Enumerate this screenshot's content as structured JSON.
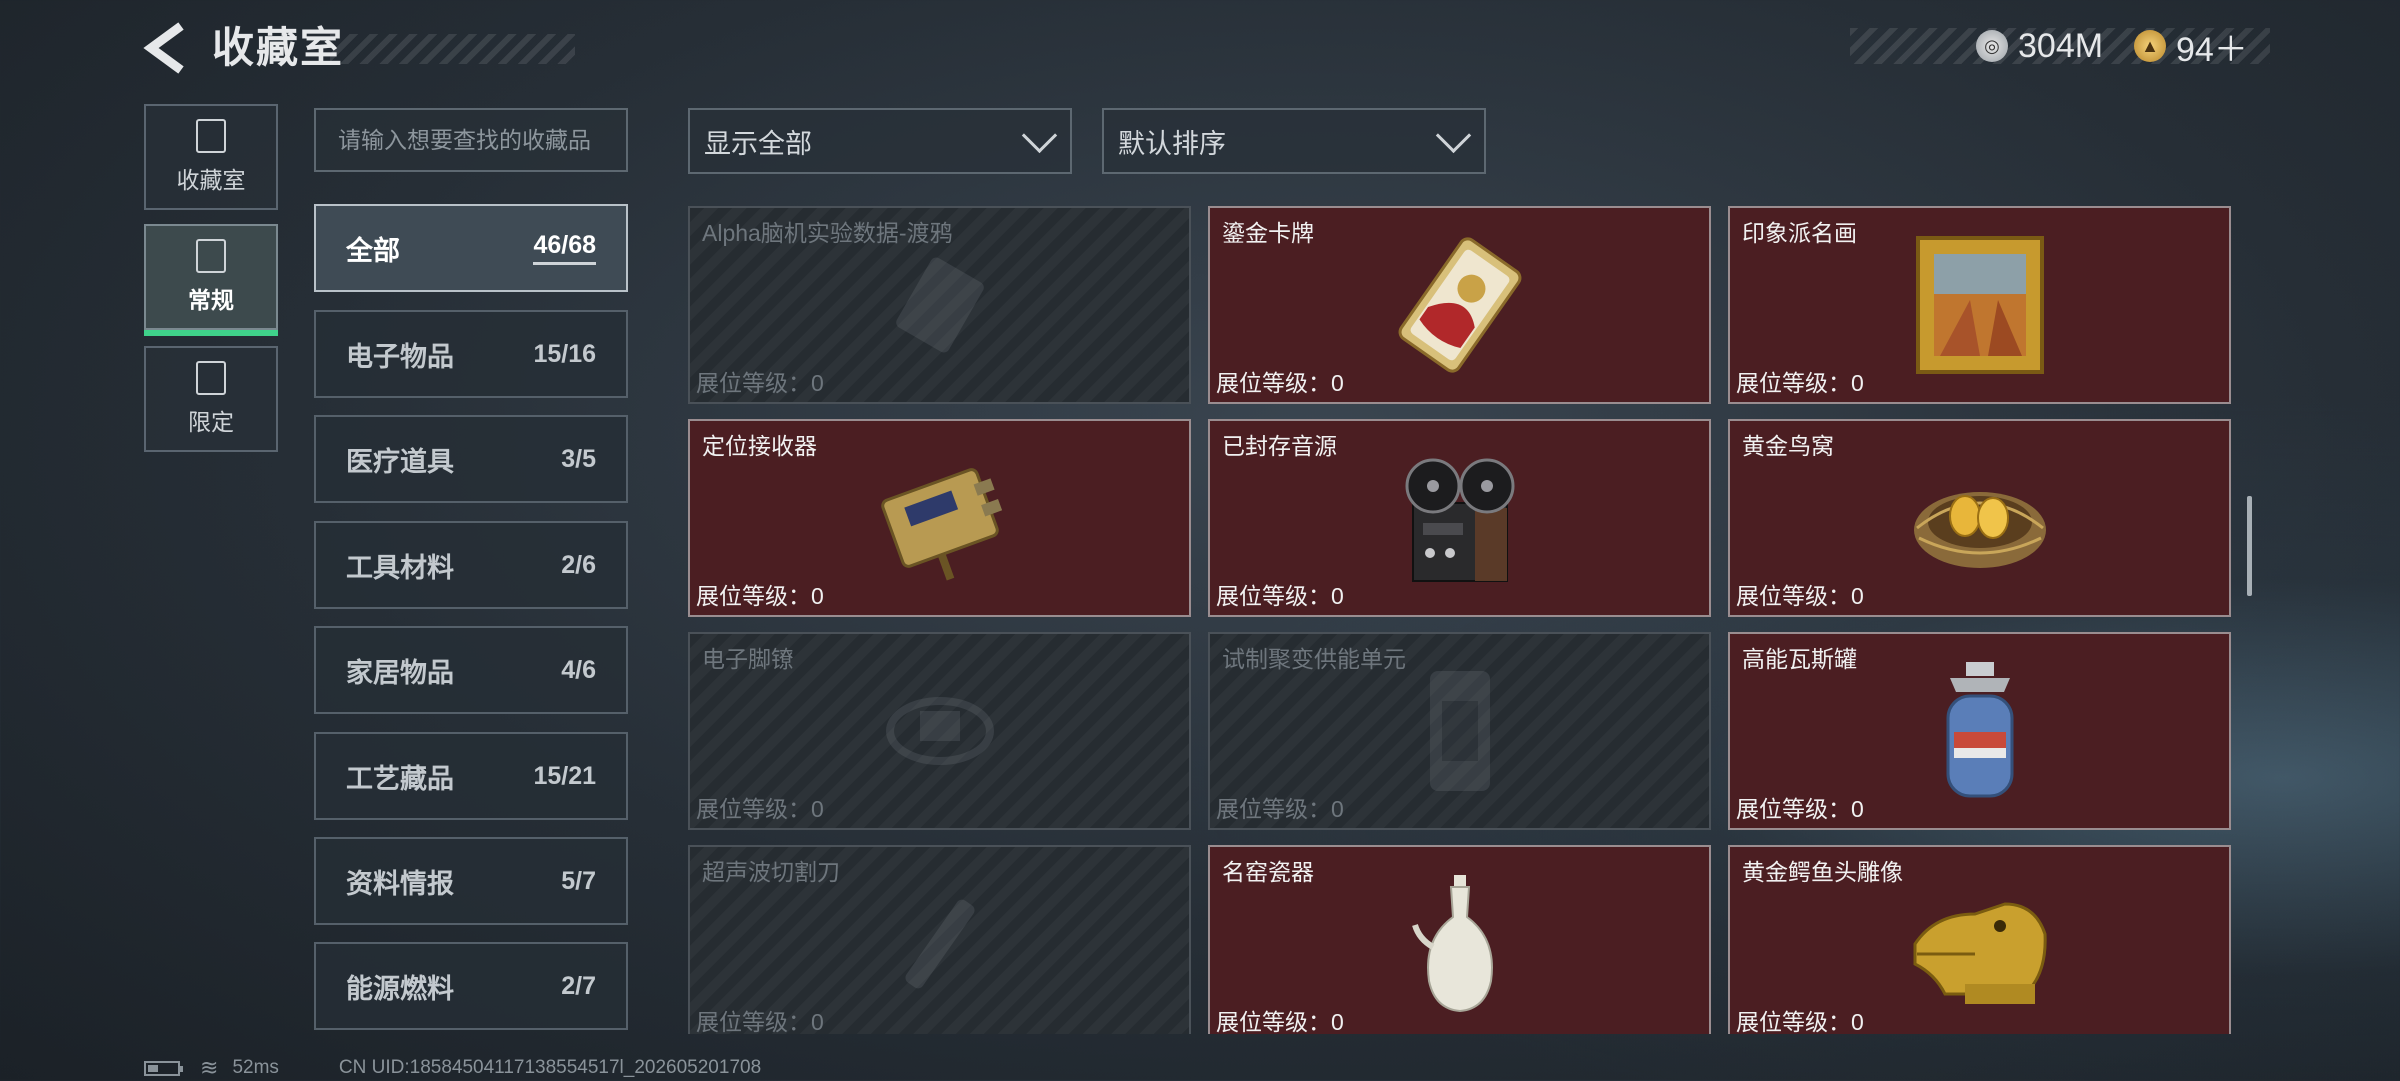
{
  "header": {
    "title": "收藏室",
    "back_icon": "back-arrow-icon"
  },
  "currency": [
    {
      "icon": "silver-coin-icon",
      "value": "304M"
    },
    {
      "icon": "gold-coin-icon",
      "value": "94＋"
    }
  ],
  "side_tabs": [
    {
      "label": "收藏室",
      "icon": "collection-room-icon",
      "active": false
    },
    {
      "label": "常规",
      "icon": "regular-icon",
      "active": true
    },
    {
      "label": "限定",
      "icon": "limited-icon",
      "active": false
    }
  ],
  "search": {
    "placeholder": "请输入想要查找的收藏品"
  },
  "categories": [
    {
      "label": "全部",
      "count": "46/68",
      "active": true
    },
    {
      "label": "电子物品",
      "count": "15/16"
    },
    {
      "label": "医疗道具",
      "count": "3/5"
    },
    {
      "label": "工具材料",
      "count": "2/6"
    },
    {
      "label": "家居物品",
      "count": "4/6"
    },
    {
      "label": "工艺藏品",
      "count": "15/21"
    },
    {
      "label": "资料情报",
      "count": "5/7"
    },
    {
      "label": "能源燃料",
      "count": "2/7"
    }
  ],
  "filters": {
    "display": "显示全部",
    "sort": "默认排序"
  },
  "items": [
    {
      "name": "Alpha脑机实验数据-渡鸦",
      "level": "展位等级：0",
      "owned": false,
      "icon": "data-drive-icon"
    },
    {
      "name": "鎏金卡牌",
      "level": "展位等级：0",
      "owned": true,
      "icon": "gilded-card-icon"
    },
    {
      "name": "印象派名画",
      "level": "展位等级：0",
      "owned": true,
      "icon": "framed-painting-icon"
    },
    {
      "name": "定位接收器",
      "level": "展位等级：0",
      "owned": true,
      "icon": "gps-receiver-icon"
    },
    {
      "name": "已封存音源",
      "level": "展位等级：0",
      "owned": true,
      "icon": "reel-tape-recorder-icon"
    },
    {
      "name": "黄金鸟窝",
      "level": "展位等级：0",
      "owned": true,
      "icon": "golden-nest-icon"
    },
    {
      "name": "电子脚镣",
      "level": "展位等级：0",
      "owned": false,
      "icon": "ankle-monitor-icon"
    },
    {
      "name": "试制聚变供能单元",
      "level": "展位等级：0",
      "owned": false,
      "icon": "fusion-cell-icon"
    },
    {
      "name": "高能瓦斯罐",
      "level": "展位等级：0",
      "owned": true,
      "icon": "gas-canister-icon"
    },
    {
      "name": "超声波切割刀",
      "level": "展位等级：0",
      "owned": false,
      "icon": "ultrasonic-cutter-icon"
    },
    {
      "name": "名窑瓷器",
      "level": "展位等级：0",
      "owned": true,
      "icon": "porcelain-vase-icon"
    },
    {
      "name": "黄金鳄鱼头雕像",
      "level": "展位等级：0",
      "owned": true,
      "icon": "golden-crocodile-head-icon"
    }
  ],
  "status_bar": {
    "ping": "52ms",
    "uid": "CN UID:18584504117138554517l_202605201708"
  }
}
